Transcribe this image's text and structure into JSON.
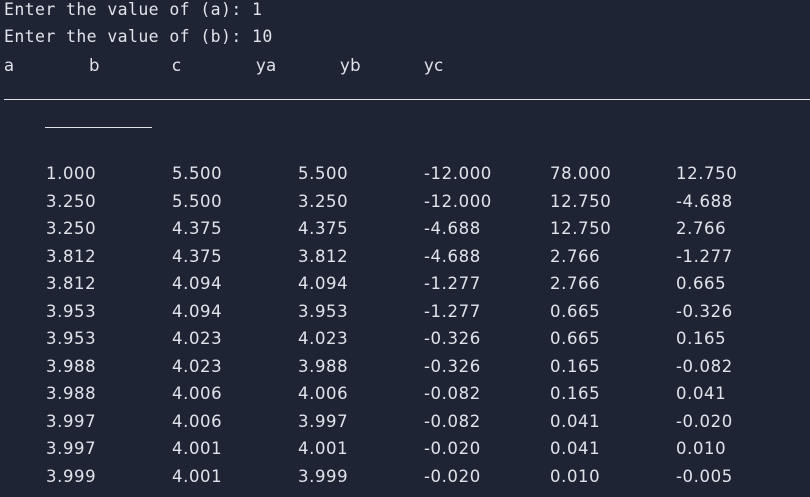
{
  "prompts": {
    "line1": "Enter the value of (a): 1",
    "line2": "Enter the value of (b): 10"
  },
  "header": {
    "a": "a",
    "b": "b",
    "c": "c",
    "ya": "ya",
    "yb": "yb",
    "yc": "yc"
  },
  "rows": [
    [
      "1.000",
      "5.500",
      "5.500",
      "-12.000",
      "78.000",
      "12.750"
    ],
    [
      "3.250",
      "5.500",
      "3.250",
      "-12.000",
      "12.750",
      "-4.688"
    ],
    [
      "3.250",
      "4.375",
      "4.375",
      "-4.688",
      "12.750",
      "2.766"
    ],
    [
      "3.812",
      "4.375",
      "3.812",
      "-4.688",
      "2.766",
      "-1.277"
    ],
    [
      "3.812",
      "4.094",
      "4.094",
      "-1.277",
      "2.766",
      "0.665"
    ],
    [
      "3.953",
      "4.094",
      "3.953",
      "-1.277",
      "0.665",
      "-0.326"
    ],
    [
      "3.953",
      "4.023",
      "4.023",
      "-0.326",
      "0.665",
      "0.165"
    ],
    [
      "3.988",
      "4.023",
      "3.988",
      "-0.326",
      "0.165",
      "-0.082"
    ],
    [
      "3.988",
      "4.006",
      "4.006",
      "-0.082",
      "0.165",
      "0.041"
    ],
    [
      "3.997",
      "4.006",
      "3.997",
      "-0.082",
      "0.041",
      "-0.020"
    ],
    [
      "3.997",
      "4.001",
      "4.001",
      "-0.020",
      "0.041",
      "0.010"
    ],
    [
      "3.999",
      "4.001",
      "3.999",
      "-0.020",
      "0.010",
      "-0.005"
    ]
  ],
  "colors": {
    "background": "#1e2433",
    "text": "#dfe3ea"
  }
}
